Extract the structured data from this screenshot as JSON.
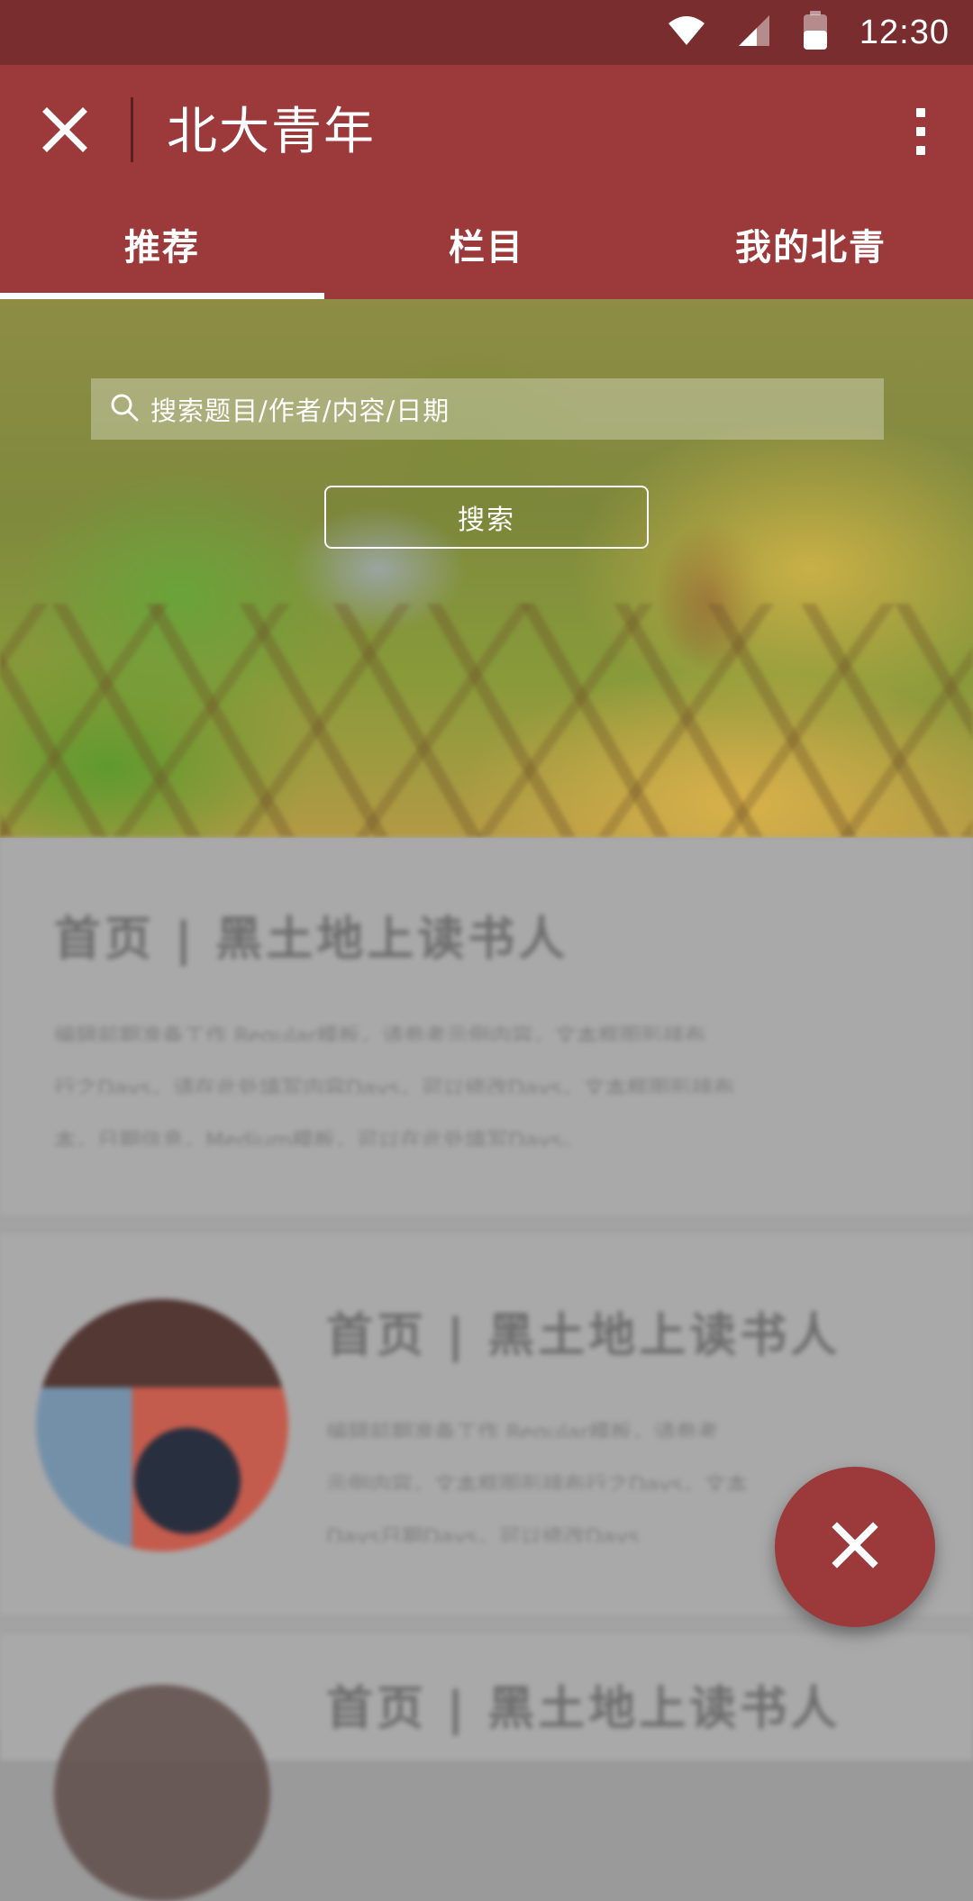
{
  "status_bar": {
    "time": "12:30",
    "icons": [
      "wifi-icon",
      "cell-signal-icon",
      "battery-icon"
    ]
  },
  "toolbar": {
    "title": "北大青年",
    "close_icon": "close-icon",
    "more_icon": "more-vert-icon"
  },
  "tabs": [
    {
      "label": "推荐",
      "selected": true
    },
    {
      "label": "栏目",
      "selected": false
    },
    {
      "label": "我的北青",
      "selected": false
    }
  ],
  "search": {
    "placeholder": "搜索题目/作者/内容/日期",
    "button_label": "搜索",
    "icon": "search-icon"
  },
  "articles": [
    {
      "title": "首页 | 黑土地上读书人",
      "excerpt_lines": [
        "编辑前期准备工作 Regular模板，请参考示例内容，文本框图形排布",
        "行之Days，请在此处填写内容Days，可以修改Days，文本框图形排布",
        "本，日期信息，Medium模板，可以在此处填写Days。"
      ]
    },
    {
      "title": "首页 | 黑土地上读书人",
      "excerpt_lines": [
        "编辑前期准备工作 Regular模板，请参考",
        "示例内容，文本框图形排布行之Days，文本",
        "Days日期Days，可以修改Days"
      ]
    },
    {
      "title": "首页 | 黑土地上读书人",
      "excerpt_lines": []
    }
  ],
  "fab": {
    "icon": "close-icon"
  },
  "colors": {
    "status_bar": "#7a2d2e",
    "app_bar": "#9b393b",
    "accent_white": "#ffffff",
    "overlay_grey": "#a3a3a3"
  }
}
